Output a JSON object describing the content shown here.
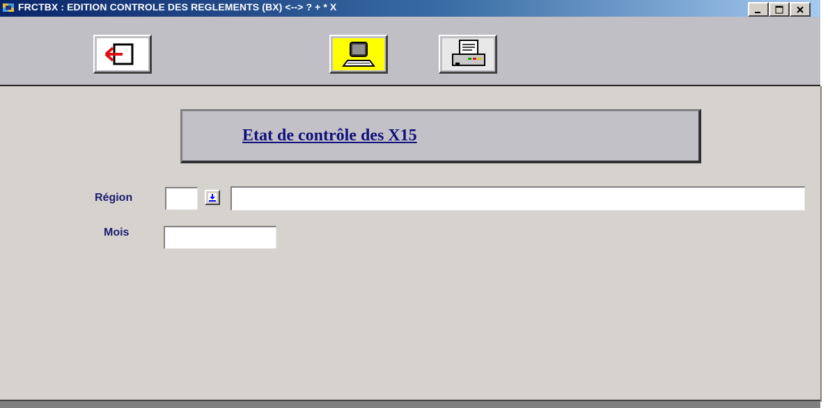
{
  "window": {
    "title": "FRCTBX : EDITION CONTROLE DES REGLEMENTS (BX) <--> ? + * X",
    "controls": {
      "minimize_icon": "minimize-icon",
      "maximize_icon": "maximize-icon",
      "close_icon": "close-icon"
    }
  },
  "toolbar": {
    "buttons": [
      {
        "name": "exit-button",
        "icon": "exit-door-icon",
        "accent": "#e01010"
      },
      {
        "name": "screen-preview-button",
        "icon": "computer-screen-icon",
        "accent": "#ffff00"
      },
      {
        "name": "print-button",
        "icon": "printer-icon",
        "accent": "#00a000"
      }
    ]
  },
  "header": {
    "title": "Etat de contrôle des X15 "
  },
  "form": {
    "region": {
      "label": "Région",
      "code_value": "",
      "name_value": "",
      "dropdown_icon": "arrow-down-icon"
    },
    "mois": {
      "label": "Mois",
      "value": ""
    }
  },
  "colors": {
    "titlebar_start": "#0a246a",
    "background": "#d6d3ce",
    "toolbar": "#c0bfc6",
    "label_text": "#1a1a6e",
    "title_text": "#10107a"
  }
}
